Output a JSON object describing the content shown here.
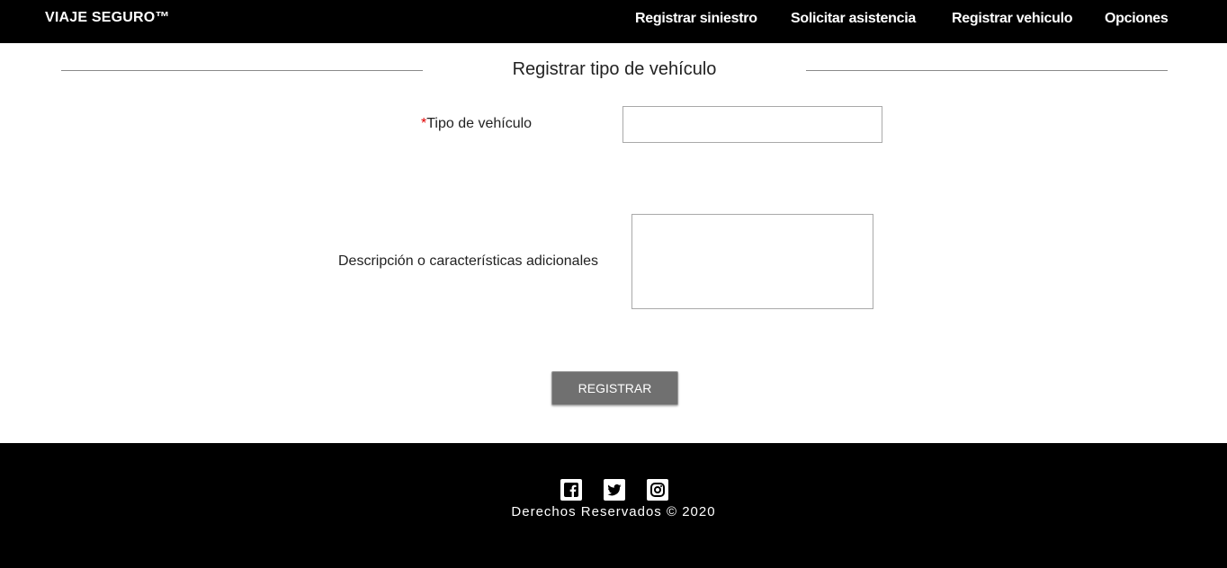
{
  "header": {
    "brand": "VIAJE SEGURO™",
    "nav": [
      {
        "label": "Registrar siniestro"
      },
      {
        "label": "Solicitar asistencia"
      },
      {
        "label": "Registrar vehiculo"
      },
      {
        "label": "Opciones"
      }
    ]
  },
  "form": {
    "title": "Registrar tipo de vehículo",
    "tipo": {
      "required_mark": "*",
      "label": "Tipo de vehículo",
      "value": "",
      "placeholder": ""
    },
    "descripcion": {
      "label": "Descripción o características adicionales",
      "value": ""
    },
    "submit_label": "REGISTRAR"
  },
  "footer": {
    "social_icons": [
      "facebook-icon",
      "twitter-icon",
      "instagram-icon"
    ],
    "copyright": "Derechos Reservados © 2020"
  },
  "colors": {
    "header_bg": "#000000",
    "footer_bg": "#000000",
    "button_bg": "#707070",
    "required": "#e00000"
  }
}
